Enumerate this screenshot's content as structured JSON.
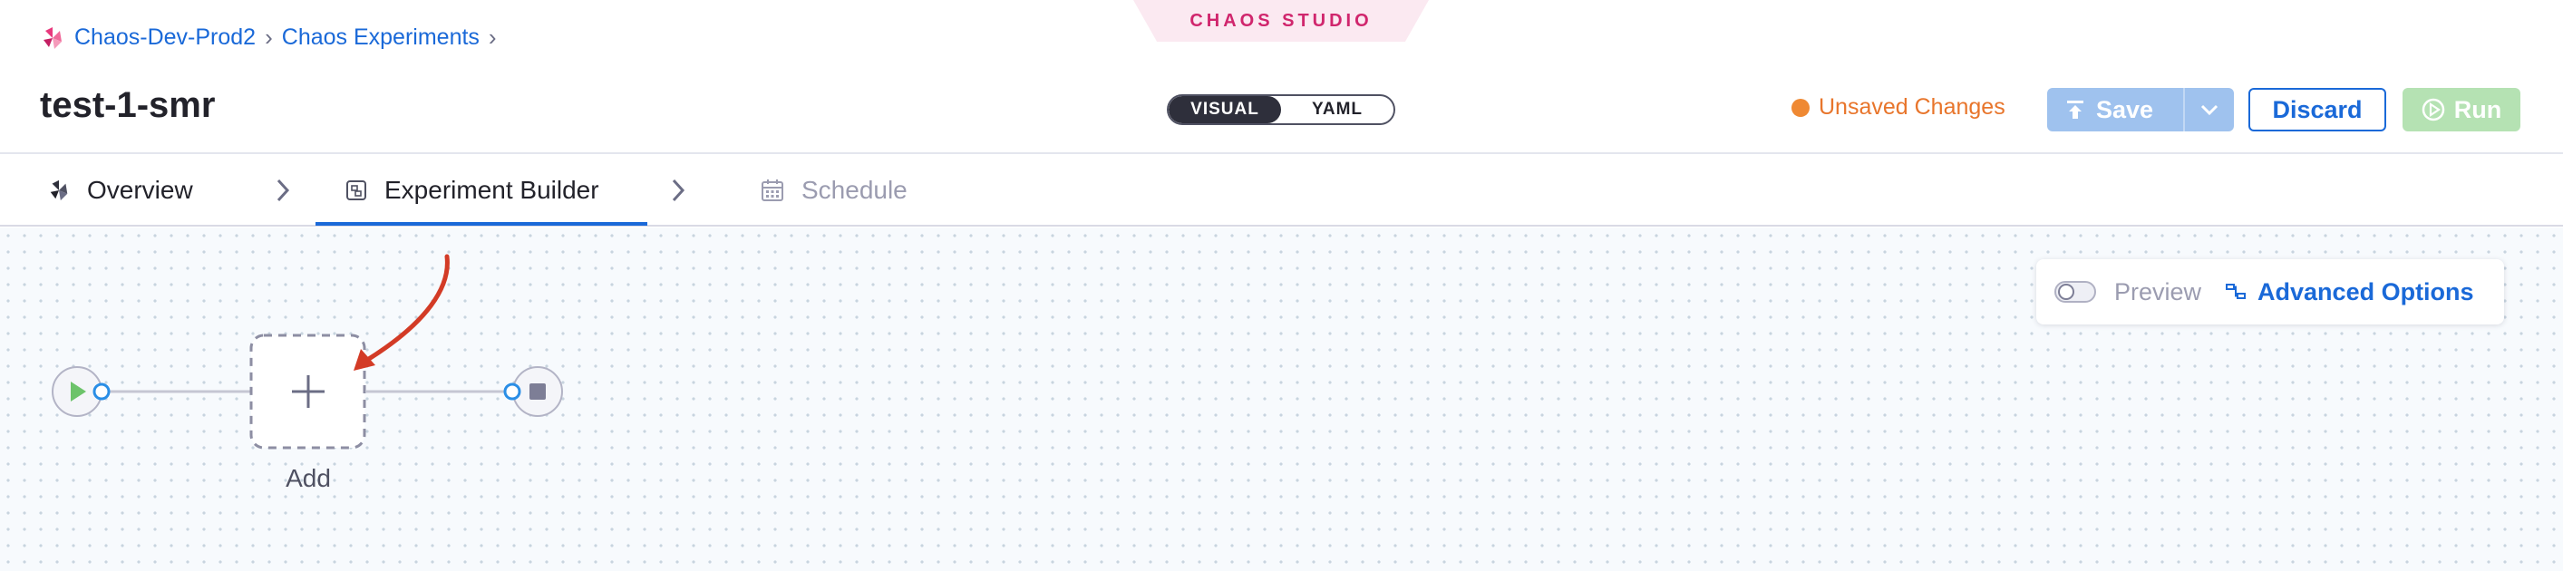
{
  "studio_badge": "CHAOS STUDIO",
  "breadcrumb": {
    "project": "Chaos-Dev-Prod2",
    "section": "Chaos Experiments"
  },
  "page_title": "test-1-smr",
  "mode_toggle": {
    "visual": "VISUAL",
    "yaml": "YAML",
    "selected": "VISUAL"
  },
  "status": {
    "unsaved_label": "Unsaved Changes",
    "color": "#e8752b"
  },
  "actions": {
    "save": "Save",
    "discard": "Discard",
    "run": "Run"
  },
  "tabs": [
    {
      "label": "Overview",
      "icon": "chaos-logo-icon",
      "state": "default"
    },
    {
      "label": "Experiment Builder",
      "icon": "builder-icon",
      "state": "active"
    },
    {
      "label": "Schedule",
      "icon": "calendar-icon",
      "state": "disabled"
    }
  ],
  "canvas": {
    "preview_label": "Preview",
    "preview_enabled": false,
    "advanced_options_label": "Advanced Options",
    "add_node_label": "Add"
  },
  "colors": {
    "accent": "#1a69d8",
    "brand": "#d0266d",
    "save_disabled": "#9fc2ee",
    "run_disabled": "#b5e2b3",
    "annotation_arrow": "#d33b26"
  }
}
